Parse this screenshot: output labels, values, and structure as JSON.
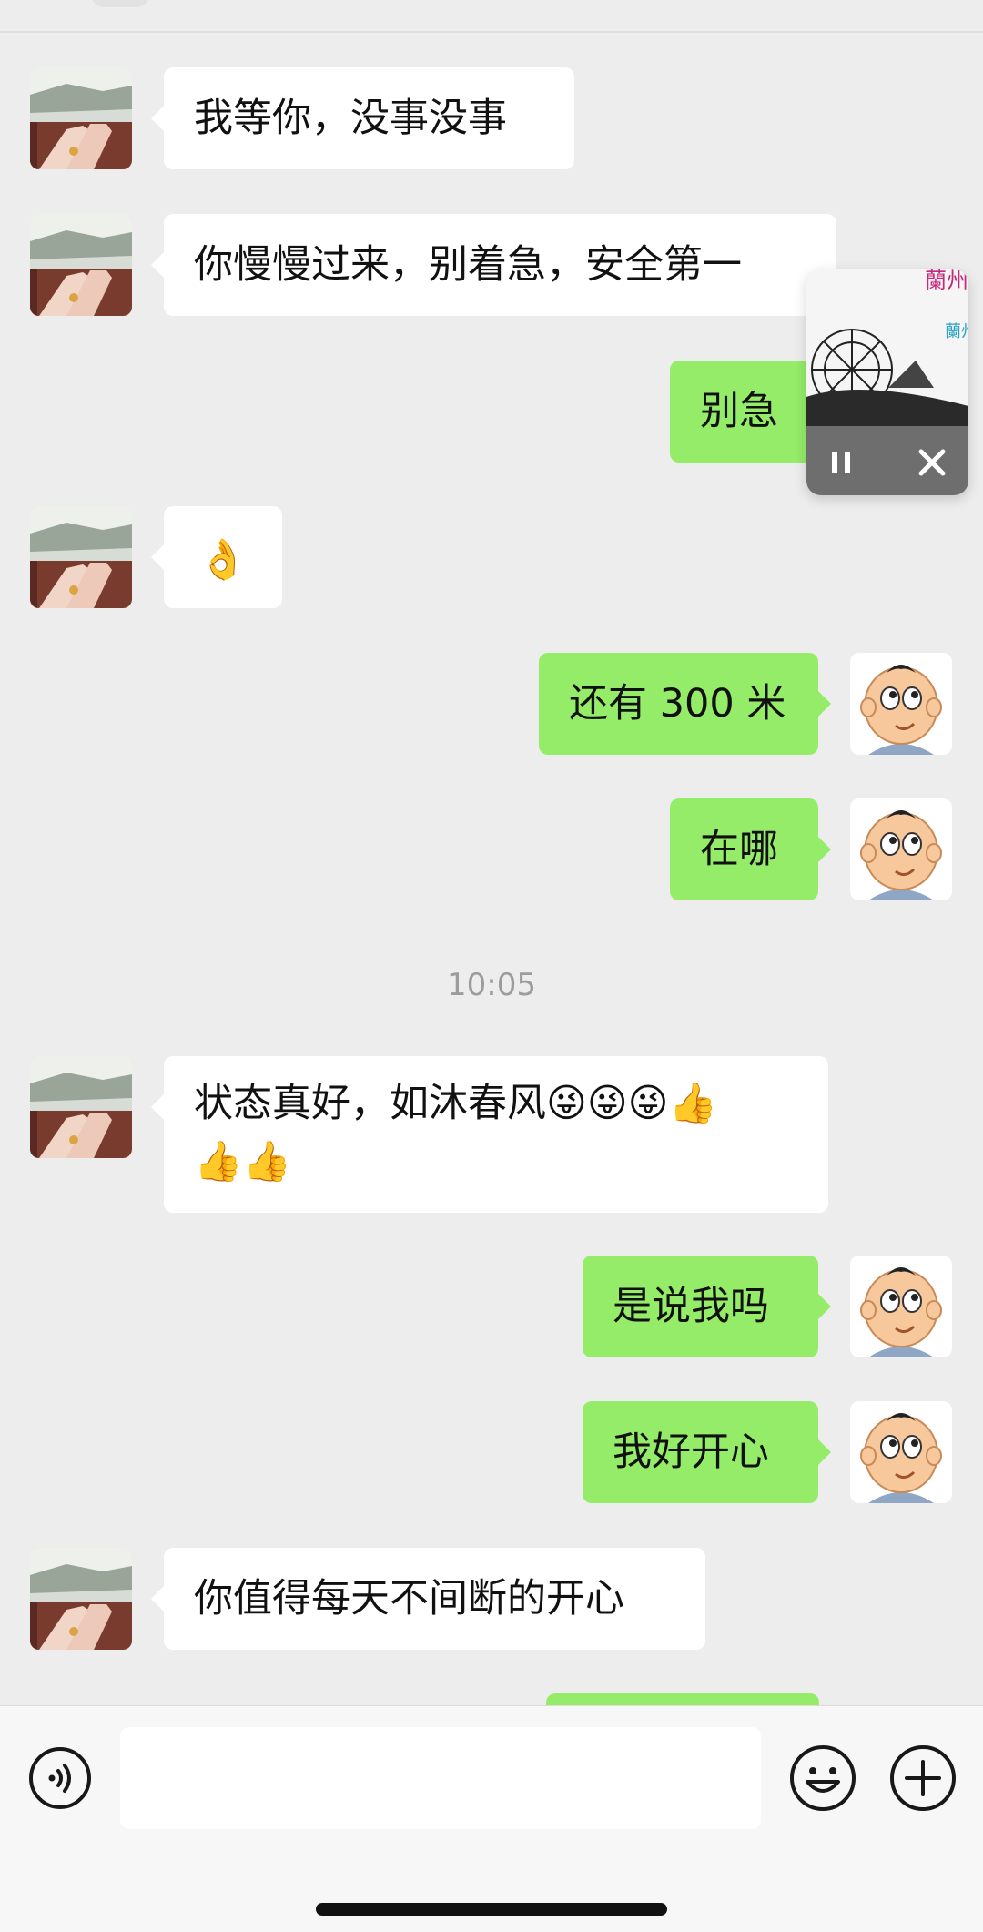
{
  "messages": [
    {
      "side": "in",
      "text": "我等你，没事没事"
    },
    {
      "side": "in",
      "text": "你慢慢过来，别着急，安全第一"
    },
    {
      "side": "out",
      "text": "别急"
    },
    {
      "side": "in",
      "text": "👌"
    },
    {
      "side": "out",
      "text": "还有 300 米"
    },
    {
      "side": "out",
      "text": "在哪"
    },
    {
      "side": "in",
      "text_line1": "状态真好，如沐春风😜😜😜👍",
      "text_line2": "👍👍"
    },
    {
      "side": "out",
      "text": "是说我吗"
    },
    {
      "side": "out",
      "text": "我好开心"
    },
    {
      "side": "in",
      "text": "你值得每天不间断的开心"
    }
  ],
  "timestamp": "10:05",
  "floating_player": {
    "title_red": "蘭州",
    "title_blue": "蘭州",
    "pause_icon": "pause-icon",
    "close_icon": "close-icon"
  },
  "input_bar": {
    "placeholder": "",
    "voice_icon": "voice-icon",
    "emoji_icon": "emoji-icon",
    "plus_icon": "plus-icon"
  },
  "colors": {
    "background": "#ededed",
    "outgoing_bubble": "#95ec69",
    "incoming_bubble": "#ffffff"
  }
}
